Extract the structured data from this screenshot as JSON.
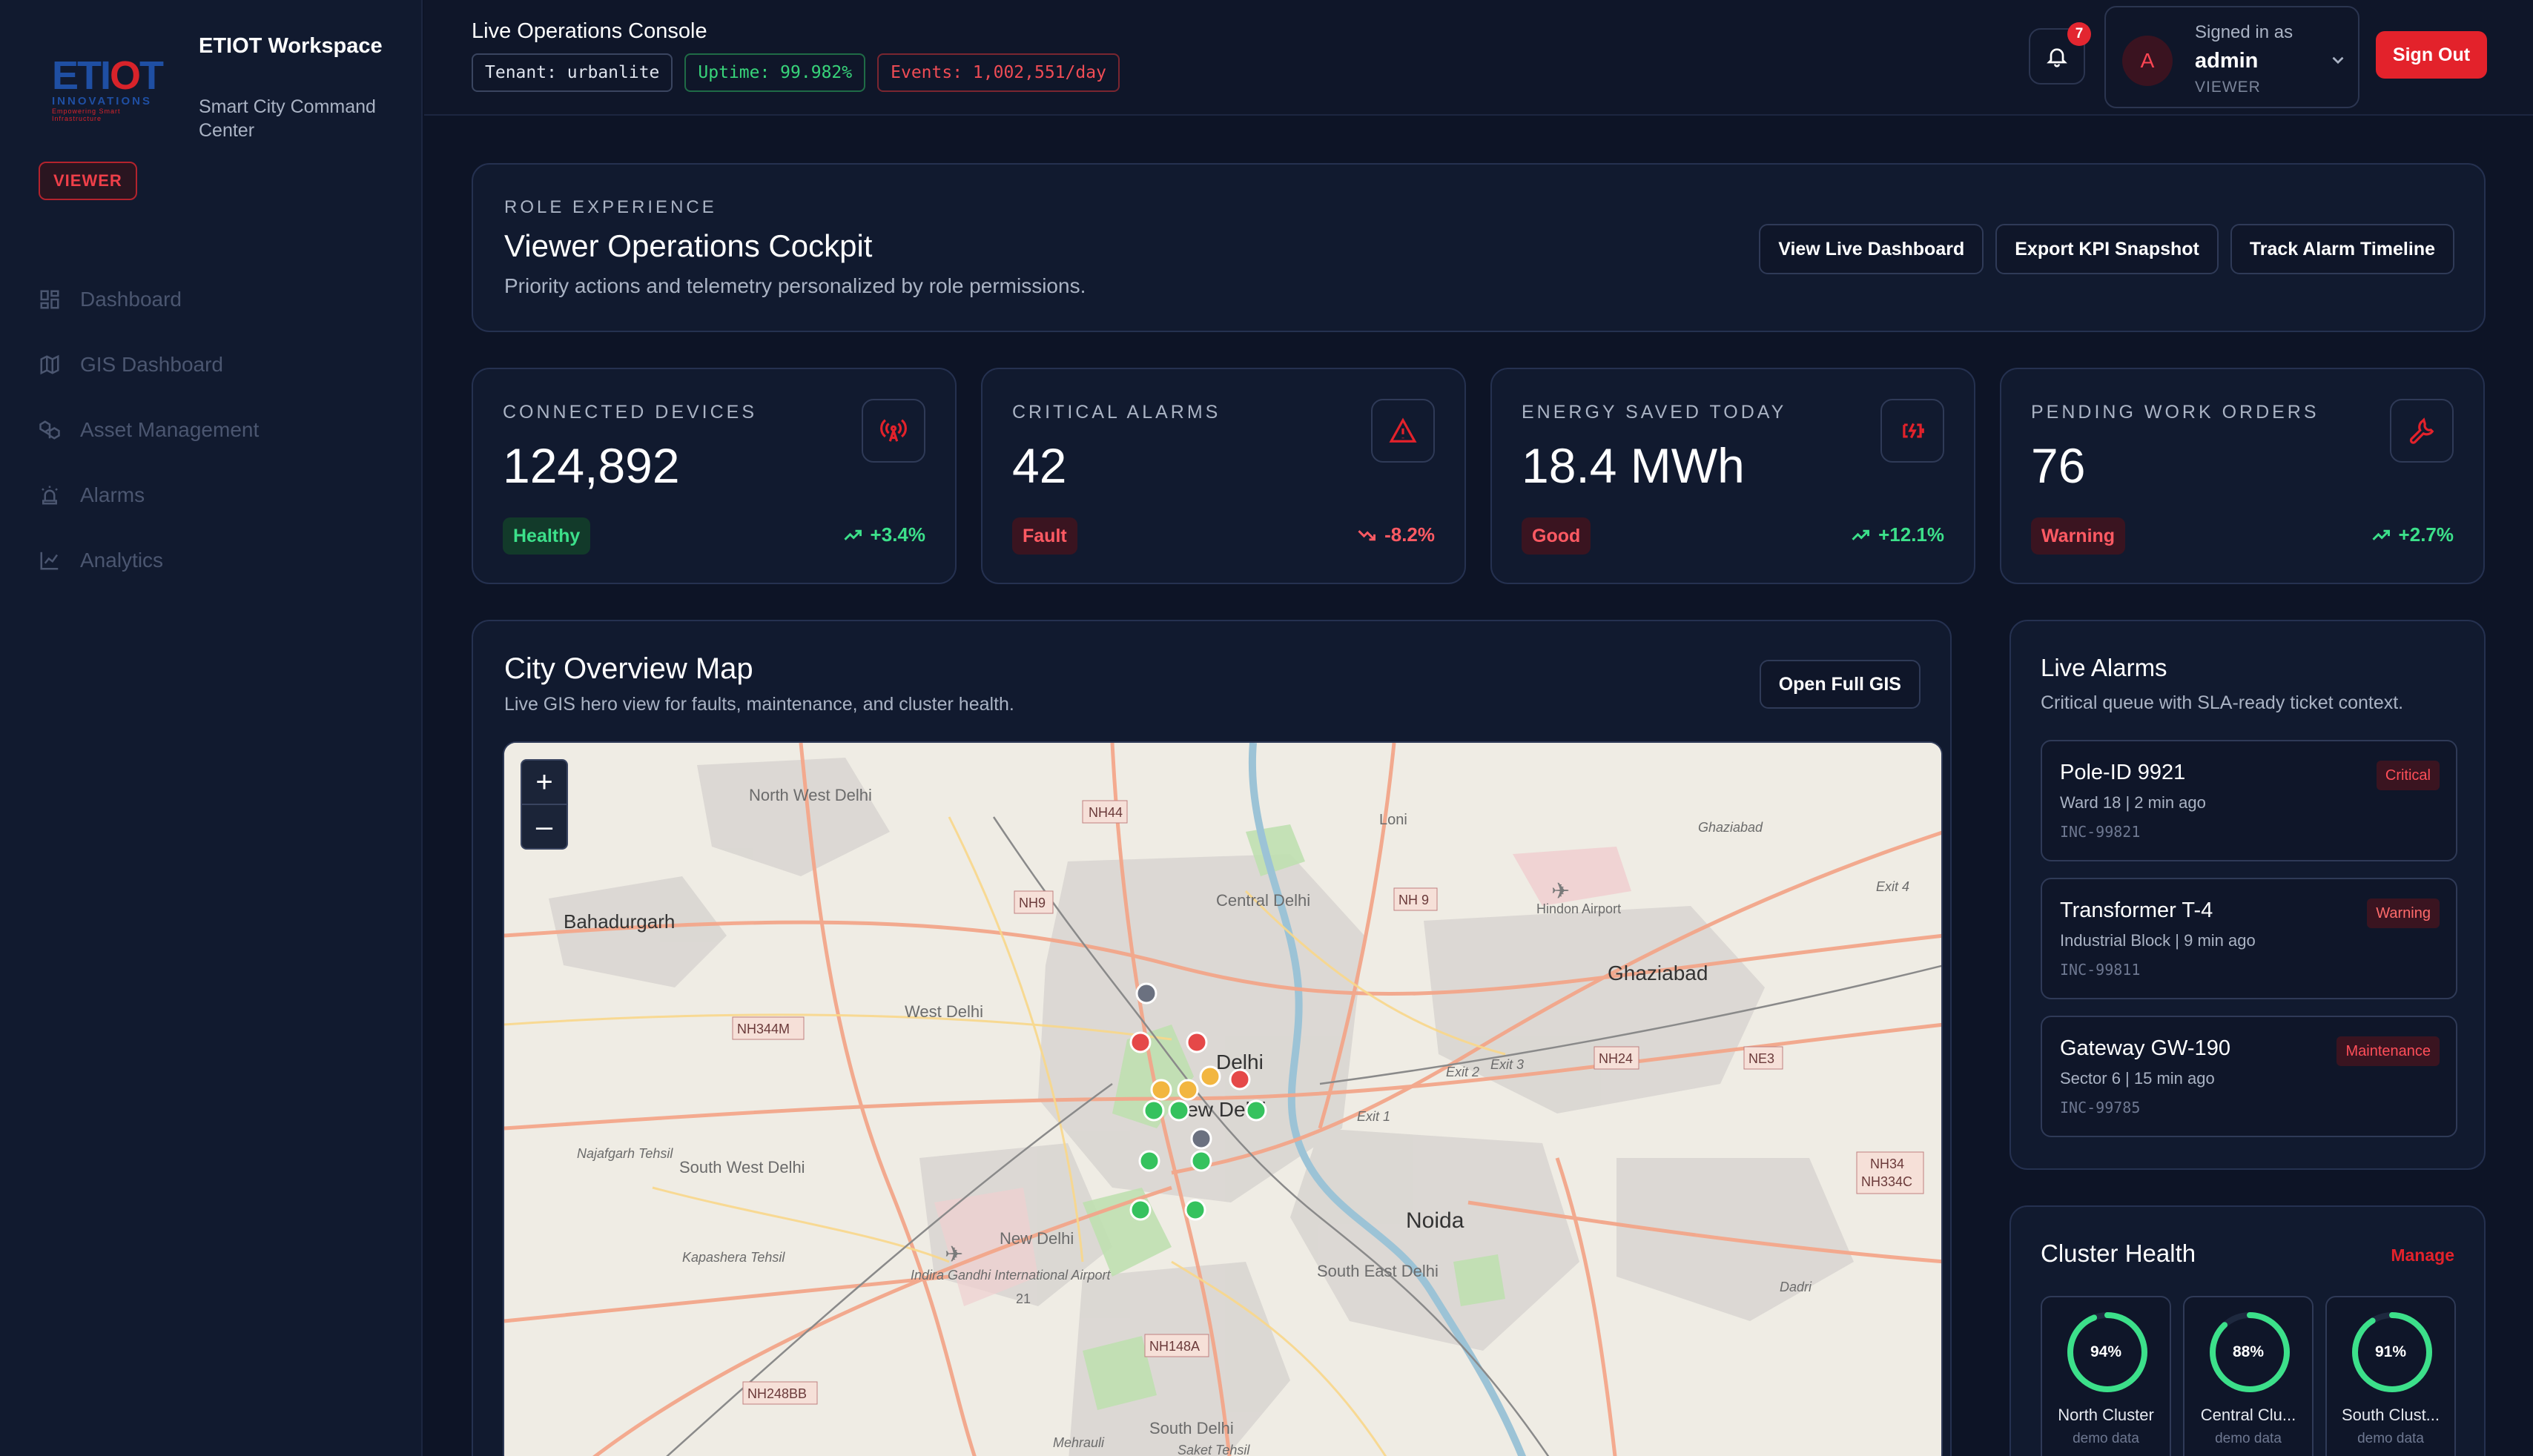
{
  "sidebar": {
    "logo": {
      "part1": "ETI",
      "part2": "O",
      "part3": "T",
      "sub": "INNOVATIONS",
      "tag": "Empowering Smart Infrastructure"
    },
    "workspace_title": "ETIOT Workspace",
    "workspace_sub": "Smart City Command Center",
    "role": "VIEWER",
    "items": [
      {
        "label": "Dashboard",
        "icon": "grid-icon"
      },
      {
        "label": "GIS Dashboard",
        "icon": "map-icon"
      },
      {
        "label": "Asset Management",
        "icon": "boxes-icon"
      },
      {
        "label": "Alarms",
        "icon": "siren-icon"
      },
      {
        "label": "Analytics",
        "icon": "chart-icon"
      }
    ]
  },
  "topbar": {
    "title": "Live Operations Console",
    "chips": {
      "tenant": "Tenant: urbanlite",
      "uptime": "Uptime: 99.982%",
      "events": "Events: 1,002,551/day"
    },
    "notifications": "7",
    "user": {
      "signed_in_as": "Signed in as",
      "name": "admin",
      "role": "VIEWER",
      "initial": "A"
    },
    "sign_out": "Sign Out"
  },
  "role_card": {
    "eyebrow": "ROLE EXPERIENCE",
    "title": "Viewer Operations Cockpit",
    "desc": "Priority actions and telemetry personalized by role permissions.",
    "actions": [
      "View Live Dashboard",
      "Export KPI Snapshot",
      "Track Alarm Timeline"
    ]
  },
  "kpis": [
    {
      "label": "CONNECTED DEVICES",
      "value": "124,892",
      "badge": "Healthy",
      "trend": "+3.4%",
      "dir": "up",
      "icon": "antenna-icon"
    },
    {
      "label": "CRITICAL ALARMS",
      "value": "42",
      "badge": "Fault",
      "trend": "-8.2%",
      "dir": "down",
      "icon": "warning-icon"
    },
    {
      "label": "ENERGY SAVED TODAY",
      "value": "18.4 MWh",
      "badge": "Good",
      "trend": "+12.1%",
      "dir": "up",
      "icon": "battery-icon"
    },
    {
      "label": "PENDING WORK ORDERS",
      "value": "76",
      "badge": "Warning",
      "trend": "+2.7%",
      "dir": "up",
      "icon": "wrench-icon"
    }
  ],
  "map": {
    "title": "City Overview Map",
    "sub": "Live GIS hero view for faults, maintenance, and cluster health.",
    "open_btn": "Open Full GIS",
    "zoom_in": "+",
    "zoom_out": "–",
    "labels": {
      "north_west_delhi": "North West Delhi",
      "bahadurgarh": "Bahadurgarh",
      "nh44": "NH44",
      "loni": "Loni",
      "nh9": "NH9",
      "central_delhi": "Central Delhi",
      "nh9b": "NH 9",
      "hindon_airport": "Hindon Airport",
      "ghaziabad_small": "Ghaziabad",
      "ghaziabad": "Ghaziabad",
      "west_delhi": "West Delhi",
      "nh344m": "NH344M",
      "delhi": "Delhi",
      "new_delhi": "New Delhi",
      "nh24": "NH24",
      "ne3": "NE3",
      "exit2": "Exit 2",
      "exit3": "Exit 3",
      "exit1": "Exit 1",
      "exit4": "Exit 4",
      "najafgarh": "Najafgarh Tehsil",
      "south_west_delhi": "South West Delhi",
      "nh34": "NH34",
      "nh334c": "NH334C",
      "noida": "Noida",
      "kapashera": "Kapashera Tehsil",
      "new_delhi_small": "New Delhi",
      "igi_airport": "Indira Gandhi International Airport",
      "south_east_delhi": "South East Delhi",
      "dadri": "Dadri",
      "nh148a": "NH148A",
      "nh248bb": "NH248BB",
      "south_delhi": "South Delhi",
      "mehrauli": "Mehrauli",
      "saket": "Saket Tehsil",
      "twenty_one": "21"
    }
  },
  "alarms": {
    "title": "Live Alarms",
    "sub": "Critical queue with SLA-ready ticket context.",
    "items": [
      {
        "name": "Pole-ID 9921",
        "meta": "Ward 18 | 2 min ago",
        "id": "INC-99821",
        "badge": "Critical"
      },
      {
        "name": "Transformer T-4",
        "meta": "Industrial Block | 9 min ago",
        "id": "INC-99811",
        "badge": "Warning"
      },
      {
        "name": "Gateway GW-190",
        "meta": "Sector 6 | 15 min ago",
        "id": "INC-99785",
        "badge": "Maintenance"
      }
    ]
  },
  "cluster": {
    "title": "Cluster Health",
    "manage": "Manage",
    "items": [
      {
        "value": "94%",
        "pct": 94,
        "name": "North Cluster",
        "sub": "demo data"
      },
      {
        "value": "88%",
        "pct": 88,
        "name": "Central Clu...",
        "sub": "demo data"
      },
      {
        "value": "91%",
        "pct": 91,
        "name": "South Clust...",
        "sub": "demo data"
      }
    ]
  },
  "colors": {
    "accent": "#e3222b",
    "good": "#3ce08a",
    "bad": "#ff5a63",
    "bg": "#0d1426",
    "card": "#111a2f"
  }
}
